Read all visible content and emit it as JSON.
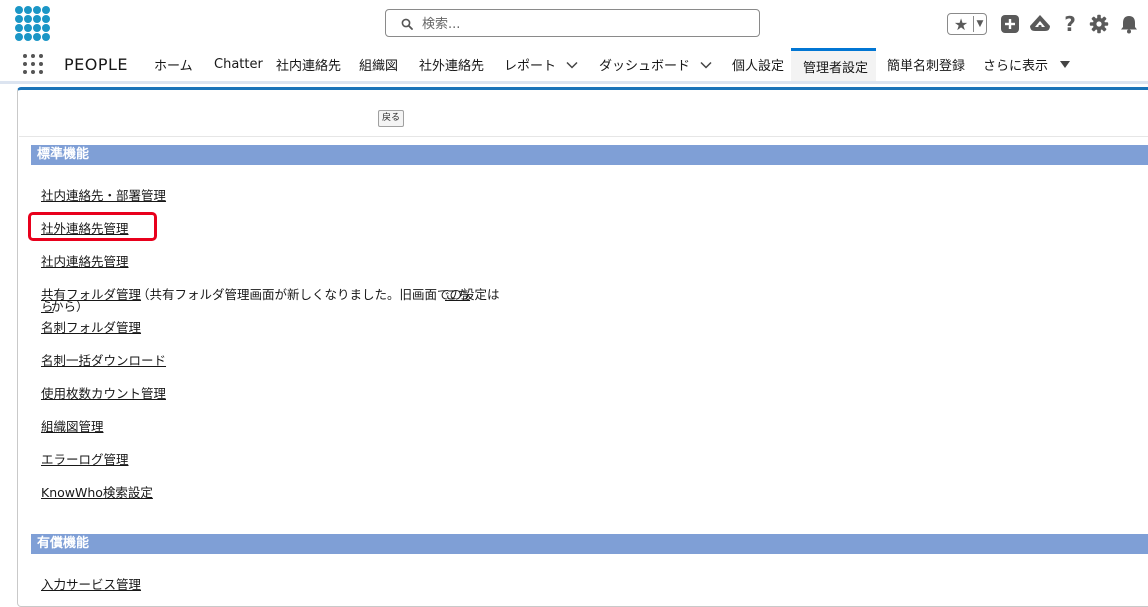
{
  "header": {
    "search_placeholder": "検索...",
    "icons": [
      "app-logo-icon",
      "search-icon",
      "star-icon",
      "chevron-down-icon",
      "add-icon",
      "trailhead-icon",
      "help-icon",
      "gear-icon",
      "bell-icon"
    ]
  },
  "nav": {
    "app_name": "PEOPLE",
    "tabs": [
      {
        "label": "ホーム"
      },
      {
        "label": "Chatter"
      },
      {
        "label": "社内連絡先"
      },
      {
        "label": "組織図"
      },
      {
        "label": "社外連絡先"
      },
      {
        "label": "レポート"
      },
      {
        "label": "ダッシュボード"
      },
      {
        "label": "個人設定"
      },
      {
        "label": "管理者設定"
      },
      {
        "label": "簡単名刺登録"
      },
      {
        "label": "さらに表示"
      }
    ],
    "active_tab": "管理者設定"
  },
  "toolbar": {
    "back_label": "戻る"
  },
  "sections": {
    "standard": {
      "title": "標準機能",
      "links": [
        "社内連絡先・部署管理",
        "社外連絡先管理",
        "社内連絡先管理",
        "共有フォルダ管理",
        "名刺フォルダ管理",
        "名刺一括ダウンロード",
        "使用枚数カウント管理",
        "組織図管理",
        "エラーログ管理",
        "KnowWho検索設定"
      ],
      "shared_folder_note": "（共有フォルダ管理画面が新しくなりました。旧画面での設定は",
      "shared_folder_note_link_1": "こち",
      "shared_folder_note_link_2": "ら",
      "shared_folder_note_end": "から）"
    },
    "paid": {
      "title": "有償機能",
      "links": [
        "入力サービス管理"
      ]
    }
  },
  "colors": {
    "brand_blue": "#1b96c6",
    "section_header": "#7f9fd6",
    "active_tab_border": "#0176d3",
    "highlight_red": "#e8001c"
  }
}
